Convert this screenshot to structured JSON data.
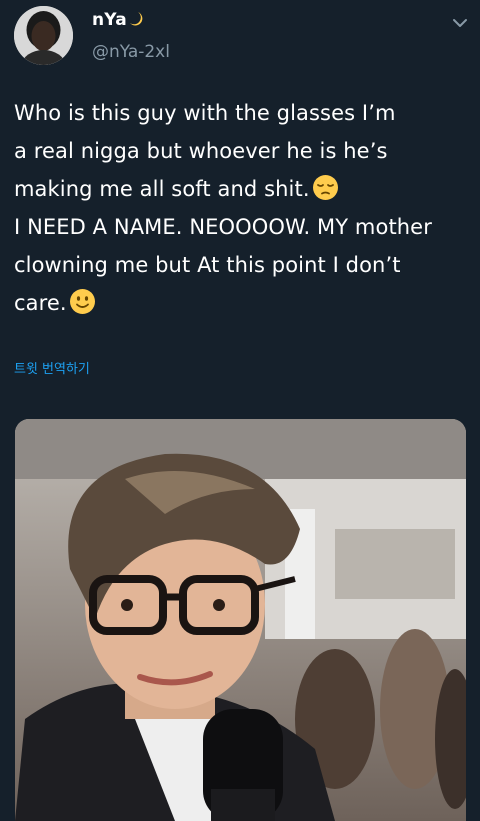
{
  "tweet": {
    "author": {
      "display_name": "nYa",
      "name_emoji": "crescent-moon-icon",
      "handle": "@nYa-2xl"
    },
    "menu_icon": "chevron-down-icon",
    "text_line1": "Who is this guy with the glasses I’m",
    "text_line2": "a real nigga but whoever he is he’s",
    "text_line3": "making me all soft and shit.",
    "text_line3_emoji": "pensive-face-icon",
    "text_line4": "I NEED A NAME. NEOOOOW. MY mother",
    "text_line5": "clowning me but At this point I don’t",
    "text_line6": "care.",
    "text_line6_emoji": "slightly-smiling-face-icon",
    "translate_label": "트윗 번역하기",
    "media": {
      "type": "video-still",
      "description_icon": "photo"
    }
  },
  "colors": {
    "background": "#15202b",
    "text": "#ffffff",
    "secondary_text": "#8899a6",
    "link": "#1da1f2",
    "emoji_yellow": "#ffcc4d"
  }
}
